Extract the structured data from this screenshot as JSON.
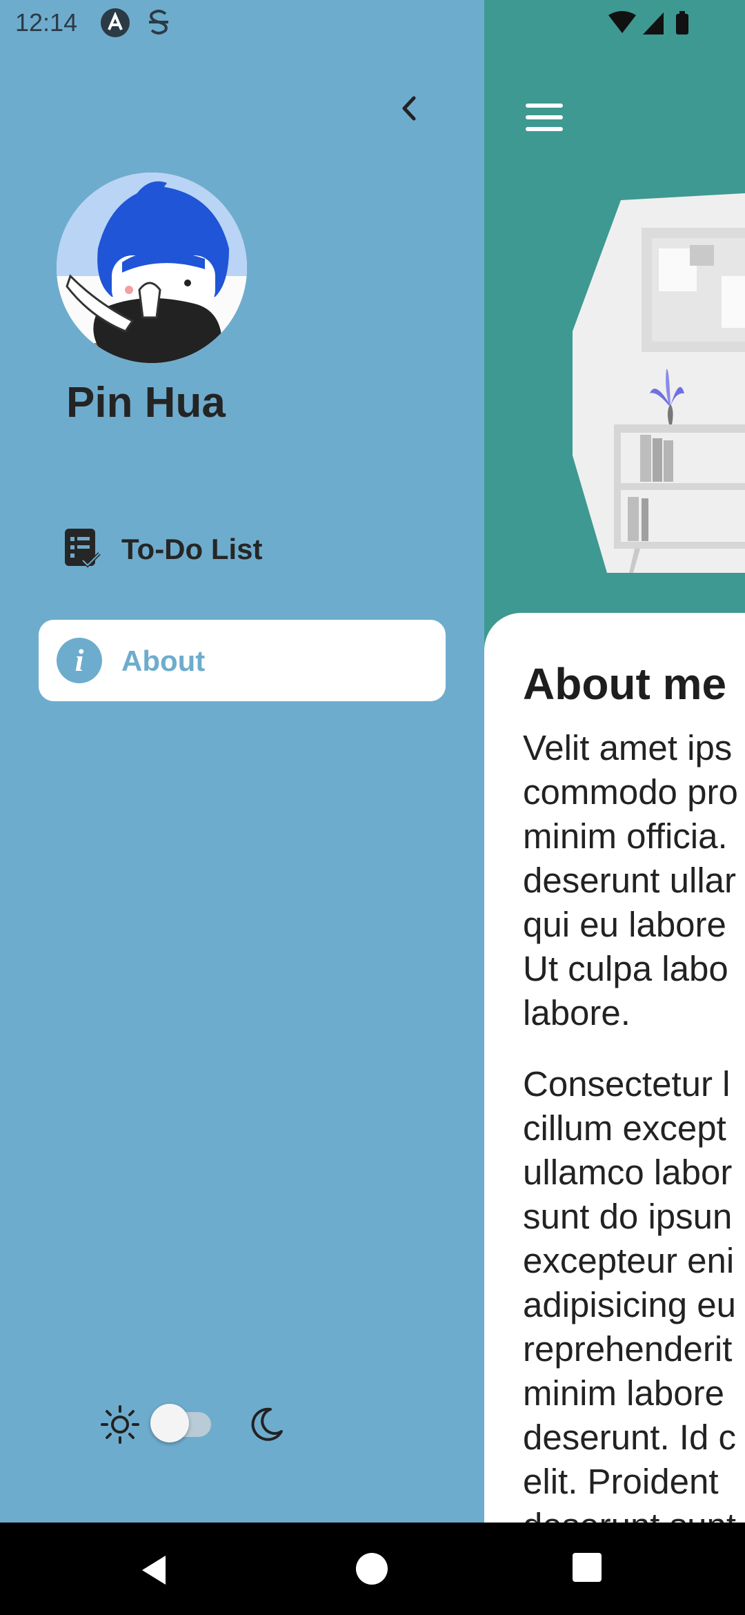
{
  "status_bar": {
    "time": "12:14",
    "icons": [
      "app-a-icon",
      "s-icon",
      "wifi-icon",
      "signal-icon",
      "battery-icon"
    ]
  },
  "drawer": {
    "background_color": "#6eaccd",
    "user_name": "Pin Hua",
    "nav_items": [
      {
        "label": "To-Do List",
        "icon": "checklist-icon",
        "selected": false
      },
      {
        "label": "About",
        "icon": "info-icon",
        "selected": true
      }
    ],
    "theme_toggle": {
      "left_icon": "sun-icon",
      "right_icon": "moon-icon",
      "dark_mode": false
    }
  },
  "main": {
    "background_color": "#3d9991",
    "section_title": "About me",
    "paragraphs": [
      "Velit amet ips\ncommodo pro\nminim officia.\ndeserunt ullar\nqui eu labore\nUt culpa labo\nlabore.",
      "Consectetur l\ncillum except\nullamco labor\nsunt do ipsun\nexcepteur eni\nadipisicing eu\nreprehenderit\nminim labore\ndeserunt. Id c\nelit. Proident\ndeserunt sunt"
    ]
  },
  "system_nav": [
    "back-button",
    "home-button",
    "recents-button"
  ]
}
